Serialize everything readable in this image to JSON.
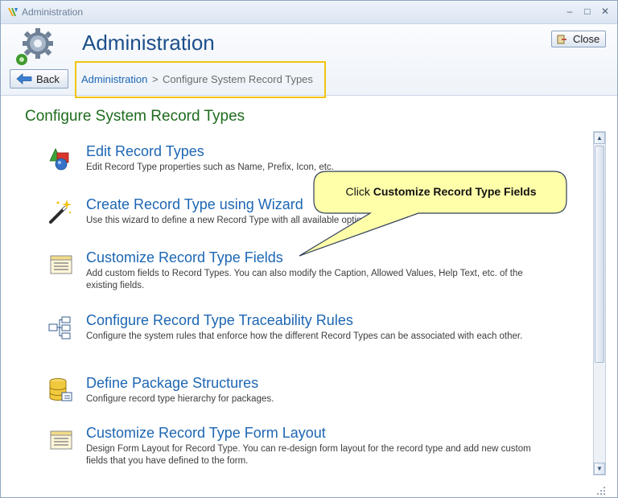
{
  "window": {
    "title": "Administration"
  },
  "header": {
    "title": "Administration",
    "back_label": "Back",
    "close_label": "Close",
    "breadcrumb": {
      "link": "Administration",
      "separator": ">",
      "current": "Configure System Record Types"
    }
  },
  "section": {
    "title": "Configure System Record Types"
  },
  "items": [
    {
      "title": "Edit Record Types",
      "description": "Edit Record Type properties such as Name, Prefix, Icon, etc.",
      "icon": "record-types-icon"
    },
    {
      "title": "Create Record Type using Wizard",
      "description": "Use this wizard to define a new Record Type with all available options.",
      "icon": "wizard-wand-icon"
    },
    {
      "title": "Customize Record Type Fields",
      "description": "Add custom fields to Record Types. You can also modify the Caption, Allowed Values, Help Text, etc. of the existing fields.",
      "icon": "form-fields-icon"
    },
    {
      "title": "Configure Record Type Traceability Rules",
      "description": "Configure the system rules that enforce how the different Record Types can be associated with each other.",
      "icon": "traceability-tree-icon"
    },
    {
      "title": "Define Package Structures",
      "description": "Configure record type hierarchy for packages.",
      "icon": "package-database-icon"
    },
    {
      "title": "Customize Record Type Form Layout",
      "description": "Design Form Layout for Record Type. You can re-design form layout for the record type and add new custom fields that you have defined to the form.",
      "icon": "form-layout-icon"
    }
  ],
  "callout": {
    "prefix": "Click ",
    "emphasis": "Customize Record Type Fields"
  },
  "colors": {
    "accent": "#1d66b3",
    "section": "#1e6b1e",
    "highlight": "#f2c40f",
    "callout_fill": "#ffffaa"
  }
}
